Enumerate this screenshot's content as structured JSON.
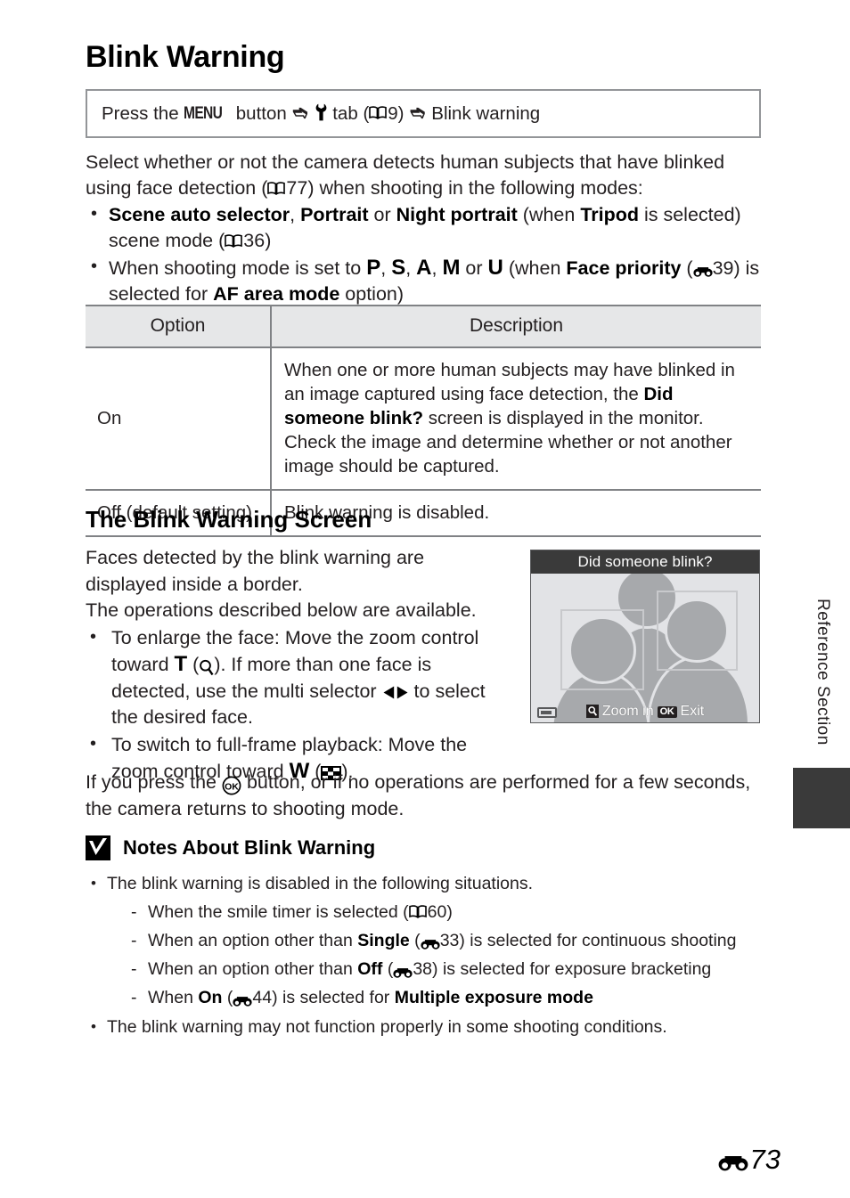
{
  "page": {
    "title": "Blink Warning",
    "number": "73",
    "number_prefix_icon": "nikon-e-reference-icon",
    "sidebar_label": "Reference Section"
  },
  "menu_path": {
    "press_the": "Press the",
    "menu_button": "MENU",
    "button_word": "button",
    "arrow": "➜",
    "tab_icon": "wrench-setup-tab-icon",
    "tab_word": "tab",
    "ref_open_paren": "(",
    "ref_book_icon": "open-book-icon",
    "ref_page": "9",
    "ref_close_paren": ")",
    "destination": "Blink warning"
  },
  "intro": {
    "line1": "Select whether or not the camera detects human subjects that have blinked",
    "line2_a": "using face detection (",
    "line2_ref": "77",
    "line2_b": ") when shooting in the following modes:",
    "bullets": [
      {
        "parts": [
          {
            "t": "Scene auto selector",
            "b": true
          },
          {
            "t": ", ",
            "b": false
          },
          {
            "t": "Portrait",
            "b": true
          },
          {
            "t": " or ",
            "b": false
          },
          {
            "t": "Night portrait",
            "b": true
          },
          {
            "t": " (when ",
            "b": false
          },
          {
            "t": "Tripod",
            "b": true
          },
          {
            "t": " is selected) scene mode (",
            "b": false
          },
          {
            "t": "36",
            "b": false,
            "ref": "book"
          },
          {
            "t": ")",
            "b": false
          }
        ]
      },
      {
        "parts": [
          {
            "t": "When shooting mode is set to ",
            "b": false
          },
          {
            "t": "P",
            "b": true,
            "mode": true
          },
          {
            "t": ", ",
            "b": false
          },
          {
            "t": "S",
            "b": true,
            "mode": true
          },
          {
            "t": ", ",
            "b": false
          },
          {
            "t": "A",
            "b": true,
            "mode": true
          },
          {
            "t": ", ",
            "b": false
          },
          {
            "t": "M",
            "b": true,
            "mode": true
          },
          {
            "t": " or ",
            "b": false
          },
          {
            "t": "U",
            "b": true,
            "mode": true
          },
          {
            "t": " (when ",
            "b": false
          },
          {
            "t": "Face priority",
            "b": true
          },
          {
            "t": " (",
            "b": false
          },
          {
            "t": "39",
            "b": false,
            "ref": "e"
          },
          {
            "t": ") is selected for ",
            "b": false
          },
          {
            "t": "AF area mode",
            "b": true
          },
          {
            "t": " option)",
            "b": false
          }
        ]
      }
    ]
  },
  "option_table": {
    "headers": {
      "option": "Option",
      "description": "Description"
    },
    "rows": [
      {
        "option": "On",
        "description_l1": "When one or more human subjects may have blinked in an",
        "description_l2a": "image captured using face detection, the ",
        "description_l2b": "Did someone",
        "description_l3a": "blink?",
        "description_l3b": " screen is displayed in the monitor.",
        "description_l4": "Check the image and determine whether or not another",
        "description_l5": "image should be captured."
      },
      {
        "option": "Off (default setting)",
        "description_l1": "Blink warning is disabled."
      }
    ]
  },
  "blink_screen_section": {
    "heading": "The Blink Warning Screen",
    "para1_l1": "Faces detected by the blink warning are",
    "para1_l2": "displayed inside a border.",
    "para2": "The operations described below are available.",
    "bullet1": {
      "a": "To enlarge the face: Move the zoom control toward ",
      "t_letter": "T",
      "b": " (",
      "mag_icon": "magnifier-icon",
      "c": "). If more than one face is detected, use the multi selector ",
      "lr_icon": "multi-selector-left-right-icon",
      "d": " to select the desired face."
    },
    "bullet2": {
      "a": "To switch to full-frame playback: Move the zoom control toward ",
      "w_letter": "W",
      "b": " (",
      "thumb_icon": "thumbnail-grid-icon",
      "c": ")."
    },
    "closing_a": "If you press the ",
    "closing_ok_icon": "ok-button-icon",
    "closing_b": " button, or if no operations are performed for a few seconds,",
    "closing_c": "the camera returns to shooting mode."
  },
  "monitor": {
    "header_title": "Did someone blink?",
    "zoom_in_icon": "magnifier-icon",
    "zoom_in_label": "Zoom in",
    "ok_badge": "OK",
    "exit_label": "Exit",
    "battery_icon": "battery-icon"
  },
  "notes": {
    "icon": "caution-check-icon",
    "heading": "Notes About Blink Warning",
    "bullet1": "The blink warning is disabled in the following situations.",
    "sub_items": [
      {
        "parts": [
          {
            "t": "When the smile timer is selected (",
            "b": false
          },
          {
            "t": "60",
            "b": false,
            "ref": "book"
          },
          {
            "t": ")",
            "b": false
          }
        ]
      },
      {
        "parts": [
          {
            "t": "When an option other than ",
            "b": false
          },
          {
            "t": "Single",
            "b": true
          },
          {
            "t": " (",
            "b": false
          },
          {
            "t": "33",
            "b": false,
            "ref": "e"
          },
          {
            "t": ") is selected for continuous shooting",
            "b": false
          }
        ]
      },
      {
        "parts": [
          {
            "t": "When an option other than ",
            "b": false
          },
          {
            "t": "Off",
            "b": true
          },
          {
            "t": " (",
            "b": false
          },
          {
            "t": "38",
            "b": false,
            "ref": "e"
          },
          {
            "t": ") is selected for exposure bracketing",
            "b": false
          }
        ]
      },
      {
        "parts": [
          {
            "t": "When ",
            "b": false
          },
          {
            "t": "On",
            "b": true
          },
          {
            "t": " (",
            "b": false
          },
          {
            "t": "44",
            "b": false,
            "ref": "e"
          },
          {
            "t": ") is selected for ",
            "b": false
          },
          {
            "t": "Multiple exposure mode",
            "b": true
          }
        ]
      }
    ],
    "bullet2": "The blink warning may not function properly in some shooting conditions."
  },
  "colors": {
    "text": "#231f20",
    "rule": "#808285",
    "table_header_bg": "#e6e7e8",
    "monitor_header_bg": "#3a3a3a",
    "monitor_bg": "#e2e3e6",
    "figure_gray": "#a7a9ac",
    "face_box": "#c8c9cc",
    "sidebar_tab": "#3a3a3a"
  }
}
